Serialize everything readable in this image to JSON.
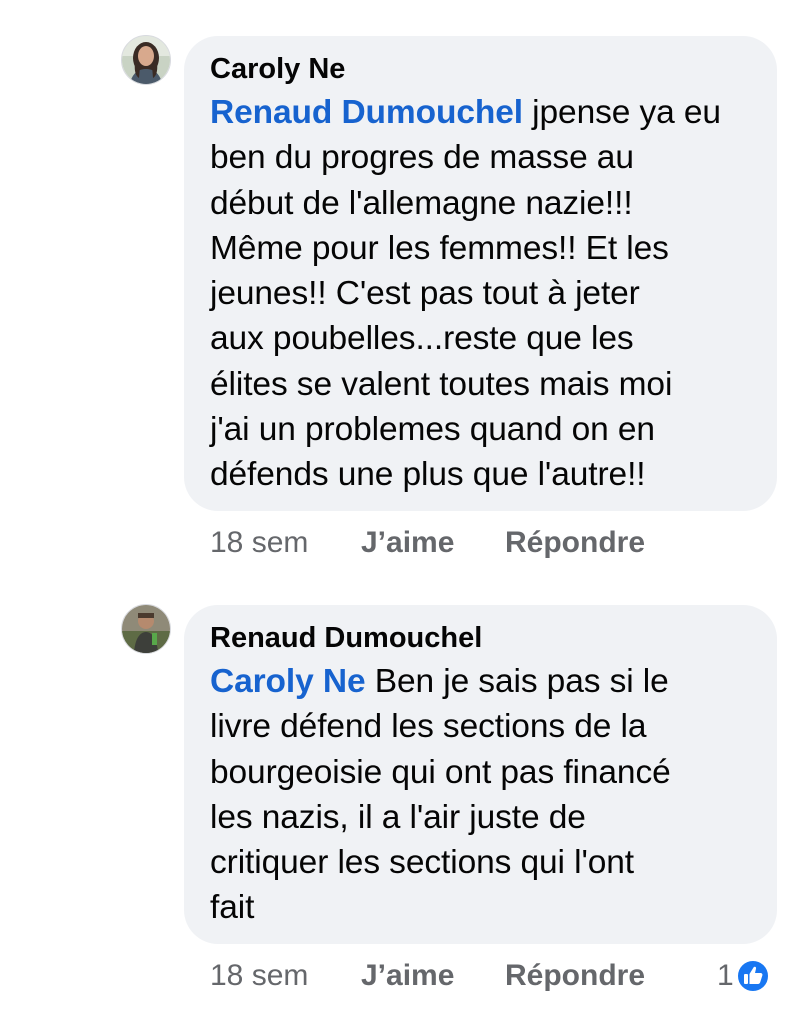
{
  "comments": [
    {
      "author": "Caroly Ne",
      "mention": "Renaud Dumouchel",
      "lines": [
        " jpense ya eu",
        "ben du progres de masse au",
        "début de l'allemagne nazie!!!",
        "Même pour les femmes!! Et les",
        "jeunes!! C'est pas tout à jeter",
        "aux poubelles...reste que les",
        "élites se valent toutes mais moi",
        "j'ai un problemes quand on en",
        "défends une plus que l'autre!!"
      ],
      "time": "18 sem",
      "like_label": "J’aime",
      "reply_label": "Répondre",
      "avatar_icon": "profile-photo-woman"
    },
    {
      "author": "Renaud Dumouchel",
      "mention": "Caroly Ne",
      "lines": [
        " Ben je sais pas si le",
        "livre défend les sections de la",
        "bourgeoisie qui ont pas financé",
        "les nazis, il a l'air juste de",
        "critiquer les sections qui l'ont",
        "fait"
      ],
      "time": "18 sem",
      "like_label": "J’aime",
      "reply_label": "Répondre",
      "reaction_count": "1",
      "reaction_icon": "thumbs-up-icon",
      "avatar_icon": "profile-photo-man"
    }
  ],
  "colors": {
    "bubble": "#f0f2f5",
    "mention": "#1763cf",
    "meta": "#65676b",
    "like_badge": "#1877f2"
  }
}
